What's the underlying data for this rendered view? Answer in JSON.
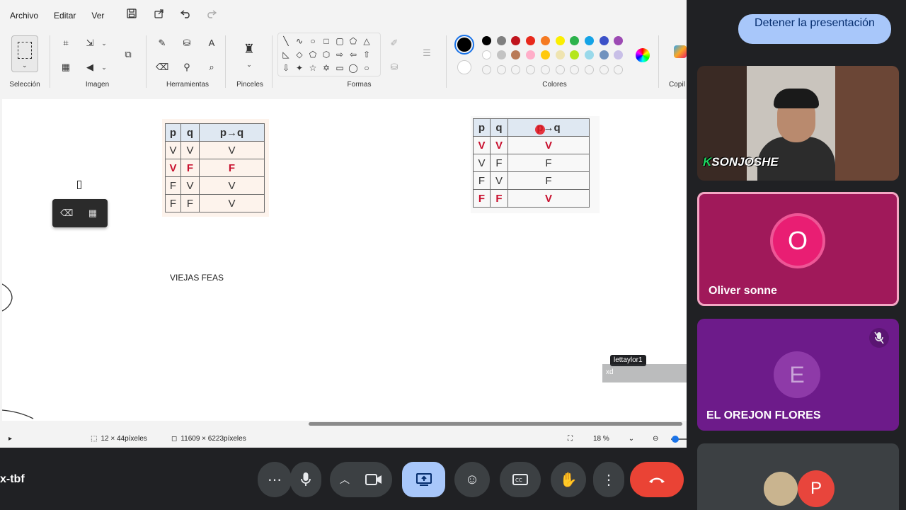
{
  "menu": [
    "Archivo",
    "Editar",
    "Ver"
  ],
  "ribbon_groups": {
    "seleccion": "Selección",
    "imagen": "Imagen",
    "herramientas": "Herramientas",
    "pinceles": "Pinceles",
    "formas": "Formas",
    "colores": "Colores",
    "copilot": "Copil"
  },
  "palette": {
    "row1": [
      "#000000",
      "#7f7f7f",
      "#c0141d",
      "#e8291c",
      "#f57a22",
      "#fbee00",
      "#2cb24b",
      "#14a3e6",
      "#3c51c8",
      "#9c4ab3"
    ],
    "row2": [
      "#ffffff",
      "#c3c3c3",
      "#b97a57",
      "#ffaec9",
      "#ffc90e",
      "#efe4b0",
      "#b5e61d",
      "#99d9ea",
      "#7092be",
      "#c8bfe7"
    ]
  },
  "canvas": {
    "table1": {
      "header": [
        "p",
        "q",
        "p→q"
      ],
      "rows": [
        [
          "V",
          "V",
          "V"
        ],
        [
          "V",
          "F",
          "F"
        ],
        [
          "F",
          "V",
          "V"
        ],
        [
          "F",
          "F",
          "V"
        ]
      ]
    },
    "table2": {
      "header": [
        "p",
        "q",
        "p→q"
      ],
      "rows": [
        [
          "V",
          "V",
          "V"
        ],
        [
          "V",
          "F",
          "F"
        ],
        [
          "F",
          "V",
          "F"
        ],
        [
          "F",
          "F",
          "V"
        ]
      ]
    },
    "text_note": "VIEJAS FEAS"
  },
  "chat": {
    "sender": "lettaylor1",
    "message": "xd"
  },
  "status": {
    "selection_size": "12 × 44píxeles",
    "image_size": "11609 × 6223píxeles",
    "zoom": "18 %"
  },
  "meeting": {
    "code_fragment": "x-tbf",
    "stop_presenting": "Detener la presentación"
  },
  "participants": [
    {
      "name": "SONJOSHE",
      "overlay_text": "SONJOSHE"
    },
    {
      "name": "Oliver sonne",
      "initial": "O",
      "color": "#a0195a"
    },
    {
      "name": "EL OREJON FLORES",
      "initial": "E",
      "color": "#6d1b8a",
      "muted": true
    },
    {
      "name": "",
      "initial": "P",
      "color": "#e8453c"
    }
  ]
}
